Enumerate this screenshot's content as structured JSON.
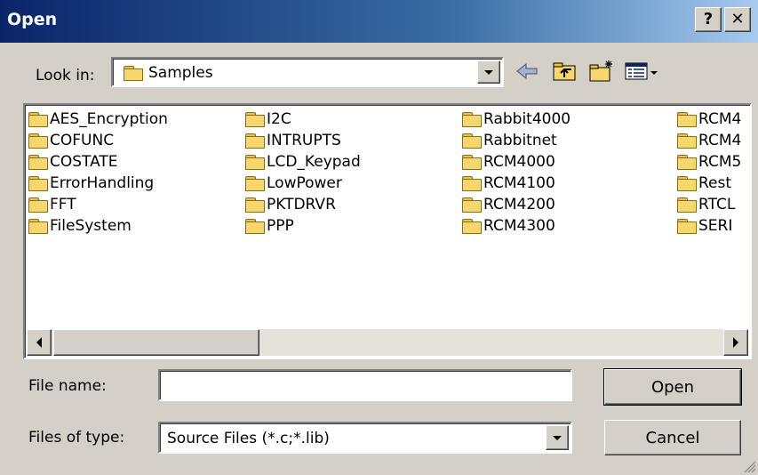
{
  "window": {
    "title": "Open",
    "help_label": "?",
    "close_label": "✕"
  },
  "look_in": {
    "label": "Look in:",
    "value": "Samples"
  },
  "toolbar": {
    "icons": [
      "back-icon",
      "up-folder-icon",
      "new-folder-icon",
      "view-menu-icon"
    ]
  },
  "files": [
    [
      "AES_Encryption",
      "COFUNC",
      "COSTATE",
      "ErrorHandling",
      "FFT",
      "FileSystem"
    ],
    [
      "I2C",
      "INTRUPTS",
      "LCD_Keypad",
      "LowPower",
      "PKTDRVR",
      "PPP"
    ],
    [
      "Rabbit4000",
      "Rabbitnet",
      "RCM4000",
      "RCM4100",
      "RCM4200",
      "RCM4300"
    ],
    [
      "RCM4",
      "RCM4",
      "RCM5",
      "Rest",
      "RTCL",
      "SERI"
    ]
  ],
  "file_name": {
    "label": "File name:",
    "value": ""
  },
  "file_type": {
    "label": "Files of type:",
    "value": "Source Files (*.c;*.lib)"
  },
  "buttons": {
    "open": "Open",
    "cancel": "Cancel"
  },
  "colors": {
    "title_start": "#0a246a",
    "title_end": "#a6caf0",
    "face": "#d4d0c8"
  }
}
